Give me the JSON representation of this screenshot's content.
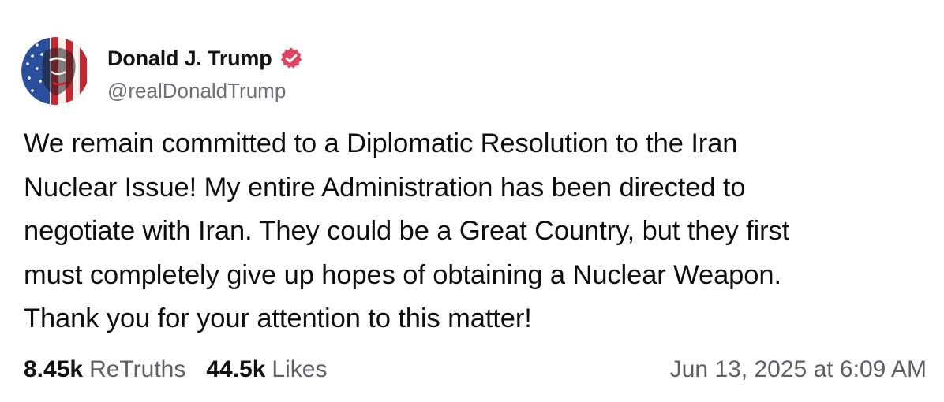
{
  "author": {
    "display_name": "Donald J. Trump",
    "handle": "@realDonaldTrump",
    "avatar_icon": "flag-portrait-avatar",
    "verified_icon": "verified-badge-icon",
    "verified_color": "#E0435F"
  },
  "post": {
    "text": "We remain committed to a Diplomatic Resolution to the Iran\nNuclear Issue! My entire Administration has been directed to\nnegotiate with Iran. They could be a Great Country, but they first\nmust completely give up hopes of obtaining a Nuclear Weapon.\nThank you for your attention to this matter!"
  },
  "stats": {
    "retruths_count": "8.45k",
    "retruths_label": "ReTruths",
    "likes_count": "44.5k",
    "likes_label": "Likes"
  },
  "timestamp": "Jun 13, 2025 at 6:09 AM"
}
